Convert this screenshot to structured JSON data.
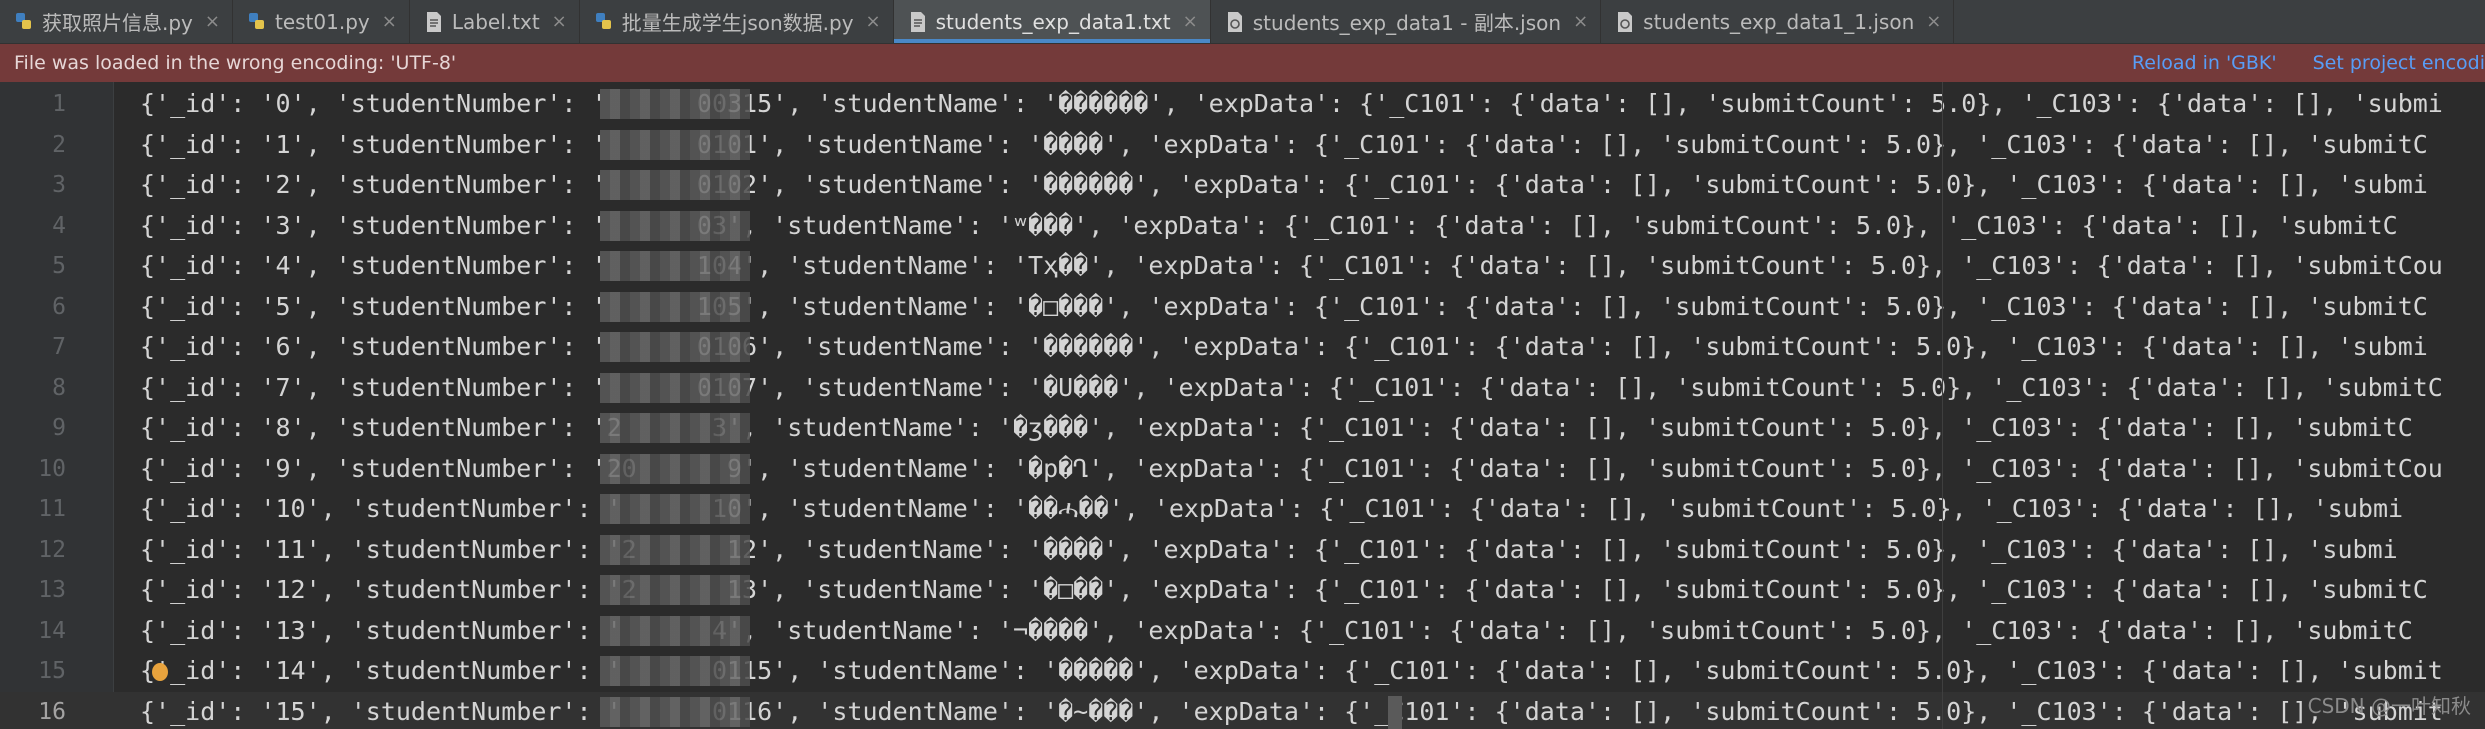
{
  "tabs": [
    {
      "label": "获取照片信息.py",
      "icon": "python-file-icon",
      "active": false
    },
    {
      "label": "test01.py",
      "icon": "python-file-icon",
      "active": false
    },
    {
      "label": "Label.txt",
      "icon": "text-file-icon",
      "active": false
    },
    {
      "label": "批量生成学生json数据.py",
      "icon": "python-file-icon",
      "active": false
    },
    {
      "label": "students_exp_data1.txt",
      "icon": "text-file-icon",
      "active": true
    },
    {
      "label": "students_exp_data1 - 副本.json",
      "icon": "json-file-icon",
      "active": false
    },
    {
      "label": "students_exp_data1_1.json",
      "icon": "json-file-icon",
      "active": false
    }
  ],
  "warning": {
    "message": "File was loaded in the wrong encoding: 'UTF-8'",
    "reload_label": "Reload in 'GBK'",
    "set_encoding_label": "Set project encodi"
  },
  "editor": {
    "current_line": 16,
    "lines": [
      {
        "n": "1",
        "text": "{'_id': '0', 'studentNumber': '      00315', 'studentName': '������', 'expData': {'_C101': {'data': [], 'submitCount': 5.0}, '_C103': {'data': [], 'submi"
      },
      {
        "n": "2",
        "text": "{'_id': '1', 'studentNumber': '      0101', 'studentName': '����', 'expData': {'_C101': {'data': [], 'submitCount': 5.0}, '_C103': {'data': [], 'submitC"
      },
      {
        "n": "3",
        "text": "{'_id': '2', 'studentNumber': '      0102', 'studentName': '������', 'expData': {'_C101': {'data': [], 'submitCount': 5.0}, '_C103': {'data': [], 'submi"
      },
      {
        "n": "4",
        "text": "{'_id': '3', 'studentNumber': '      03', 'studentName': 'ʷ���', 'expData': {'_C101': {'data': [], 'submitCount': 5.0}, '_C103': {'data': [], 'submitC"
      },
      {
        "n": "5",
        "text": "{'_id': '4', 'studentNumber': '      104', 'studentName': 'Tҳ��', 'expData': {'_C101': {'data': [], 'submitCount': 5.0}, '_C103': {'data': [], 'submitCou"
      },
      {
        "n": "6",
        "text": "{'_id': '5', 'studentNumber': '      105', 'studentName': '�□���', 'expData': {'_C101': {'data': [], 'submitCount': 5.0}, '_C103': {'data': [], 'submitC"
      },
      {
        "n": "7",
        "text": "{'_id': '6', 'studentNumber': '      0106', 'studentName': '������', 'expData': {'_C101': {'data': [], 'submitCount': 5.0}, '_C103': {'data': [], 'submi"
      },
      {
        "n": "8",
        "text": "{'_id': '7', 'studentNumber': '      0107', 'studentName': '�Ս���', 'expData': {'_C101': {'data': [], 'submitCount': 5.0}, '_C103': {'data': [], 'submitC"
      },
      {
        "n": "9",
        "text": "{'_id': '8', 'studentNumber': '2      3', 'studentName': '�ʒ���', 'expData': {'_C101': {'data': [], 'submitCount': 5.0}, '_C103': {'data': [], 'submitC"
      },
      {
        "n": "10",
        "text": "{'_id': '9', 'studentNumber': '20      9', 'studentName': '�p�Ղ', 'expData': {'_C101': {'data': [], 'submitCount': 5.0}, '_C103': {'data': [], 'submitCou"
      },
      {
        "n": "11",
        "text": "{'_id': '10', 'studentNumber': '      10', 'studentName': '��ሓ��', 'expData': {'_C101': {'data': [], 'submitCount': 5.0}, '_C103': {'data': [], 'submi"
      },
      {
        "n": "12",
        "text": "{'_id': '11', 'studentNumber': '2      12', 'studentName': '����', 'expData': {'_C101': {'data': [], 'submitCount': 5.0}, '_C103': {'data': [], 'submi"
      },
      {
        "n": "13",
        "text": "{'_id': '12', 'studentNumber': '2      13', 'studentName': '�□��', 'expData': {'_C101': {'data': [], 'submitCount': 5.0}, '_C103': {'data': [], 'submitC"
      },
      {
        "n": "14",
        "text": "{'_id': '13', 'studentNumber': '      4', 'studentName': '¬����', 'expData': {'_C101': {'data': [], 'submitCount': 5.0}, '_C103': {'data': [], 'submitC"
      },
      {
        "n": "15",
        "text": "{'_id': '14', 'studentNumber': '      0115', 'studentName': '�����', 'expData': {'_C101': {'data': [], 'submitCount': 5.0}, '_C103': {'data': [], 'submit"
      },
      {
        "n": "16",
        "text": "{'_id': '15', 'studentNumber': '      0116', 'studentName': '�~���', 'expData': {'_C101': {'data': [], 'submitCount': 5.0}, '_C103': {'data': [], 'submit"
      }
    ]
  },
  "watermark": "CSDN @一叶知秋"
}
